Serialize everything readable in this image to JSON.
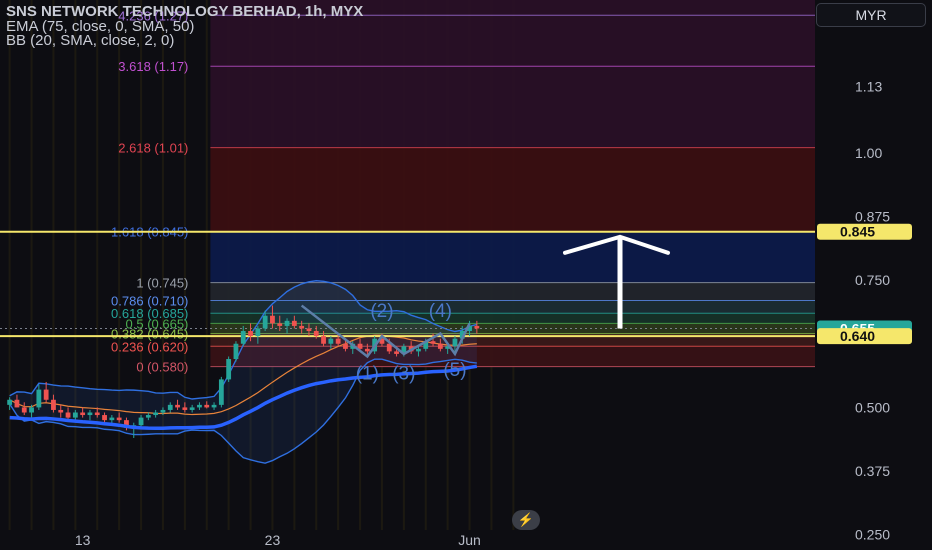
{
  "header": {
    "title": "SNS NETWORK TECHNOLOGY BERHAD, 1h, MYX",
    "ema": "EMA (75, close, 0, SMA, 50)",
    "bb": "BB (20, SMA, close, 2, 0)"
  },
  "currency_button": "MYR",
  "logo_icon": "lightning-logo-icon",
  "colors": {
    "background": "#0d0d12",
    "candle_up": "#26a69a",
    "candle_down": "#ef5350",
    "ema": "#2962ff",
    "bollinger": "#2f6fe0",
    "highlight": "#f5e76b",
    "arrow": "#ffffff"
  },
  "chart_data": {
    "type": "candlestick",
    "symbol": "SNS NETWORK TECHNOLOGY BERHAD",
    "interval": "1h",
    "exchange": "MYX",
    "ylim": [
      0.22,
      1.3
    ],
    "y_ticks": [
      1.13,
      1.0,
      0.875,
      0.75,
      0.5,
      0.375,
      0.25
    ],
    "y_tick_labels": [
      "1.13",
      "1.00",
      "0.875",
      "0.750",
      "0.500",
      "0.375",
      "0.250"
    ],
    "x_tick_labels": [
      {
        "label": "13",
        "bar": 10
      },
      {
        "label": "23",
        "bar": 36
      },
      {
        "label": "Jun",
        "bar": 63
      }
    ],
    "bar_count": 70,
    "price_tags": [
      {
        "label": "0.845",
        "value": 0.845,
        "style": "yellow"
      },
      {
        "label": "0.655",
        "value": 0.655,
        "style": "green"
      },
      {
        "label": "0.640",
        "value": 0.64,
        "style": "yellow"
      }
    ],
    "horizontal_lines": [
      0.845,
      0.64
    ],
    "fibonacci": {
      "start_bar": 28,
      "levels": [
        {
          "label": "0 (0.580)",
          "value": 0.58,
          "fill": "#3a1216"
        },
        {
          "label": "0.236 (0.620)",
          "value": 0.62,
          "fill": "#3d1a1a"
        },
        {
          "label": "0.382 (0.645)",
          "value": 0.645,
          "fill": "#2c3a1c"
        },
        {
          "label": "0.5 (0.665)",
          "value": 0.665,
          "fill": "#163329"
        },
        {
          "label": "0.618 (0.685)",
          "value": 0.685,
          "fill": "#1c2f35"
        },
        {
          "label": "0.786 (0.710)",
          "value": 0.71,
          "fill": "#22262e"
        },
        {
          "label": "1 (0.745)",
          "value": 0.745,
          "fill": "#0c1b4c"
        },
        {
          "label": "1.618 (0.845)",
          "value": 0.845,
          "fill": "#3c0e12"
        },
        {
          "label": "2.618 (1.01)",
          "value": 1.01,
          "fill": "#2a0f28"
        },
        {
          "label": "3.618 (1.17)",
          "value": 1.17,
          "fill": "#2a0f28"
        },
        {
          "label": "4.236 (1.27)",
          "value": 1.27,
          "fill": "#2a0f28"
        }
      ]
    },
    "wave_labels": [
      {
        "label": "(2)",
        "bar": 51,
        "value": 0.678
      },
      {
        "label": "(4)",
        "bar": 59,
        "value": 0.678
      },
      {
        "label": "(1)",
        "bar": 49,
        "value": 0.555
      },
      {
        "label": "(3)",
        "bar": 54,
        "value": 0.555
      },
      {
        "label": "(5)",
        "bar": 61,
        "value": 0.562
      }
    ],
    "wave_path": [
      {
        "bar": 40,
        "value": 0.7
      },
      {
        "bar": 49,
        "value": 0.6
      },
      {
        "bar": 51,
        "value": 0.64
      },
      {
        "bar": 54,
        "value": 0.605
      },
      {
        "bar": 59,
        "value": 0.645
      },
      {
        "bar": 61,
        "value": 0.605
      },
      {
        "bar": 63,
        "value": 0.665
      }
    ],
    "arrow": {
      "bar": 74,
      "from": 0.655,
      "to": 0.835
    },
    "candles": [
      {
        "o": 0.505,
        "h": 0.52,
        "l": 0.495,
        "c": 0.515
      },
      {
        "o": 0.515,
        "h": 0.525,
        "l": 0.5,
        "c": 0.5
      },
      {
        "o": 0.5,
        "h": 0.51,
        "l": 0.485,
        "c": 0.49
      },
      {
        "o": 0.49,
        "h": 0.505,
        "l": 0.48,
        "c": 0.5
      },
      {
        "o": 0.5,
        "h": 0.545,
        "l": 0.495,
        "c": 0.535
      },
      {
        "o": 0.535,
        "h": 0.55,
        "l": 0.51,
        "c": 0.515
      },
      {
        "o": 0.515,
        "h": 0.525,
        "l": 0.49,
        "c": 0.495
      },
      {
        "o": 0.495,
        "h": 0.505,
        "l": 0.48,
        "c": 0.49
      },
      {
        "o": 0.49,
        "h": 0.5,
        "l": 0.475,
        "c": 0.48
      },
      {
        "o": 0.48,
        "h": 0.495,
        "l": 0.47,
        "c": 0.49
      },
      {
        "o": 0.49,
        "h": 0.5,
        "l": 0.48,
        "c": 0.485
      },
      {
        "o": 0.485,
        "h": 0.495,
        "l": 0.475,
        "c": 0.49
      },
      {
        "o": 0.49,
        "h": 0.5,
        "l": 0.48,
        "c": 0.485
      },
      {
        "o": 0.485,
        "h": 0.49,
        "l": 0.47,
        "c": 0.475
      },
      {
        "o": 0.475,
        "h": 0.485,
        "l": 0.465,
        "c": 0.48
      },
      {
        "o": 0.48,
        "h": 0.49,
        "l": 0.47,
        "c": 0.475
      },
      {
        "o": 0.475,
        "h": 0.48,
        "l": 0.455,
        "c": 0.46
      },
      {
        "o": 0.46,
        "h": 0.47,
        "l": 0.44,
        "c": 0.465
      },
      {
        "o": 0.465,
        "h": 0.485,
        "l": 0.46,
        "c": 0.48
      },
      {
        "o": 0.48,
        "h": 0.49,
        "l": 0.475,
        "c": 0.485
      },
      {
        "o": 0.485,
        "h": 0.495,
        "l": 0.48,
        "c": 0.49
      },
      {
        "o": 0.49,
        "h": 0.5,
        "l": 0.485,
        "c": 0.495
      },
      {
        "o": 0.495,
        "h": 0.51,
        "l": 0.49,
        "c": 0.505
      },
      {
        "o": 0.505,
        "h": 0.515,
        "l": 0.495,
        "c": 0.5
      },
      {
        "o": 0.5,
        "h": 0.51,
        "l": 0.49,
        "c": 0.495
      },
      {
        "o": 0.495,
        "h": 0.505,
        "l": 0.49,
        "c": 0.5
      },
      {
        "o": 0.5,
        "h": 0.51,
        "l": 0.495,
        "c": 0.505
      },
      {
        "o": 0.505,
        "h": 0.512,
        "l": 0.498,
        "c": 0.5
      },
      {
        "o": 0.5,
        "h": 0.51,
        "l": 0.495,
        "c": 0.505
      },
      {
        "o": 0.505,
        "h": 0.56,
        "l": 0.5,
        "c": 0.555
      },
      {
        "o": 0.555,
        "h": 0.6,
        "l": 0.55,
        "c": 0.595
      },
      {
        "o": 0.595,
        "h": 0.63,
        "l": 0.59,
        "c": 0.625
      },
      {
        "o": 0.625,
        "h": 0.66,
        "l": 0.62,
        "c": 0.65
      },
      {
        "o": 0.65,
        "h": 0.665,
        "l": 0.63,
        "c": 0.64
      },
      {
        "o": 0.64,
        "h": 0.66,
        "l": 0.625,
        "c": 0.655
      },
      {
        "o": 0.655,
        "h": 0.69,
        "l": 0.65,
        "c": 0.68
      },
      {
        "o": 0.68,
        "h": 0.7,
        "l": 0.655,
        "c": 0.665
      },
      {
        "o": 0.665,
        "h": 0.68,
        "l": 0.65,
        "c": 0.66
      },
      {
        "o": 0.66,
        "h": 0.675,
        "l": 0.645,
        "c": 0.67
      },
      {
        "o": 0.67,
        "h": 0.68,
        "l": 0.655,
        "c": 0.66
      },
      {
        "o": 0.66,
        "h": 0.67,
        "l": 0.645,
        "c": 0.655
      },
      {
        "o": 0.655,
        "h": 0.665,
        "l": 0.64,
        "c": 0.65
      },
      {
        "o": 0.65,
        "h": 0.66,
        "l": 0.635,
        "c": 0.64
      },
      {
        "o": 0.64,
        "h": 0.65,
        "l": 0.62,
        "c": 0.625
      },
      {
        "o": 0.625,
        "h": 0.64,
        "l": 0.615,
        "c": 0.635
      },
      {
        "o": 0.635,
        "h": 0.645,
        "l": 0.62,
        "c": 0.625
      },
      {
        "o": 0.625,
        "h": 0.635,
        "l": 0.61,
        "c": 0.615
      },
      {
        "o": 0.615,
        "h": 0.63,
        "l": 0.605,
        "c": 0.625
      },
      {
        "o": 0.625,
        "h": 0.635,
        "l": 0.61,
        "c": 0.615
      },
      {
        "o": 0.615,
        "h": 0.625,
        "l": 0.6,
        "c": 0.61
      },
      {
        "o": 0.61,
        "h": 0.64,
        "l": 0.605,
        "c": 0.635
      },
      {
        "o": 0.635,
        "h": 0.645,
        "l": 0.62,
        "c": 0.625
      },
      {
        "o": 0.625,
        "h": 0.635,
        "l": 0.605,
        "c": 0.61
      },
      {
        "o": 0.61,
        "h": 0.62,
        "l": 0.6,
        "c": 0.605
      },
      {
        "o": 0.605,
        "h": 0.625,
        "l": 0.6,
        "c": 0.62
      },
      {
        "o": 0.62,
        "h": 0.63,
        "l": 0.605,
        "c": 0.61
      },
      {
        "o": 0.61,
        "h": 0.62,
        "l": 0.6,
        "c": 0.615
      },
      {
        "o": 0.615,
        "h": 0.635,
        "l": 0.61,
        "c": 0.63
      },
      {
        "o": 0.63,
        "h": 0.645,
        "l": 0.62,
        "c": 0.625
      },
      {
        "o": 0.625,
        "h": 0.635,
        "l": 0.61,
        "c": 0.615
      },
      {
        "o": 0.615,
        "h": 0.625,
        "l": 0.605,
        "c": 0.62
      },
      {
        "o": 0.62,
        "h": 0.64,
        "l": 0.61,
        "c": 0.635
      },
      {
        "o": 0.635,
        "h": 0.66,
        "l": 0.625,
        "c": 0.65
      },
      {
        "o": 0.65,
        "h": 0.67,
        "l": 0.64,
        "c": 0.66
      },
      {
        "o": 0.66,
        "h": 0.67,
        "l": 0.645,
        "c": 0.655
      }
    ]
  }
}
